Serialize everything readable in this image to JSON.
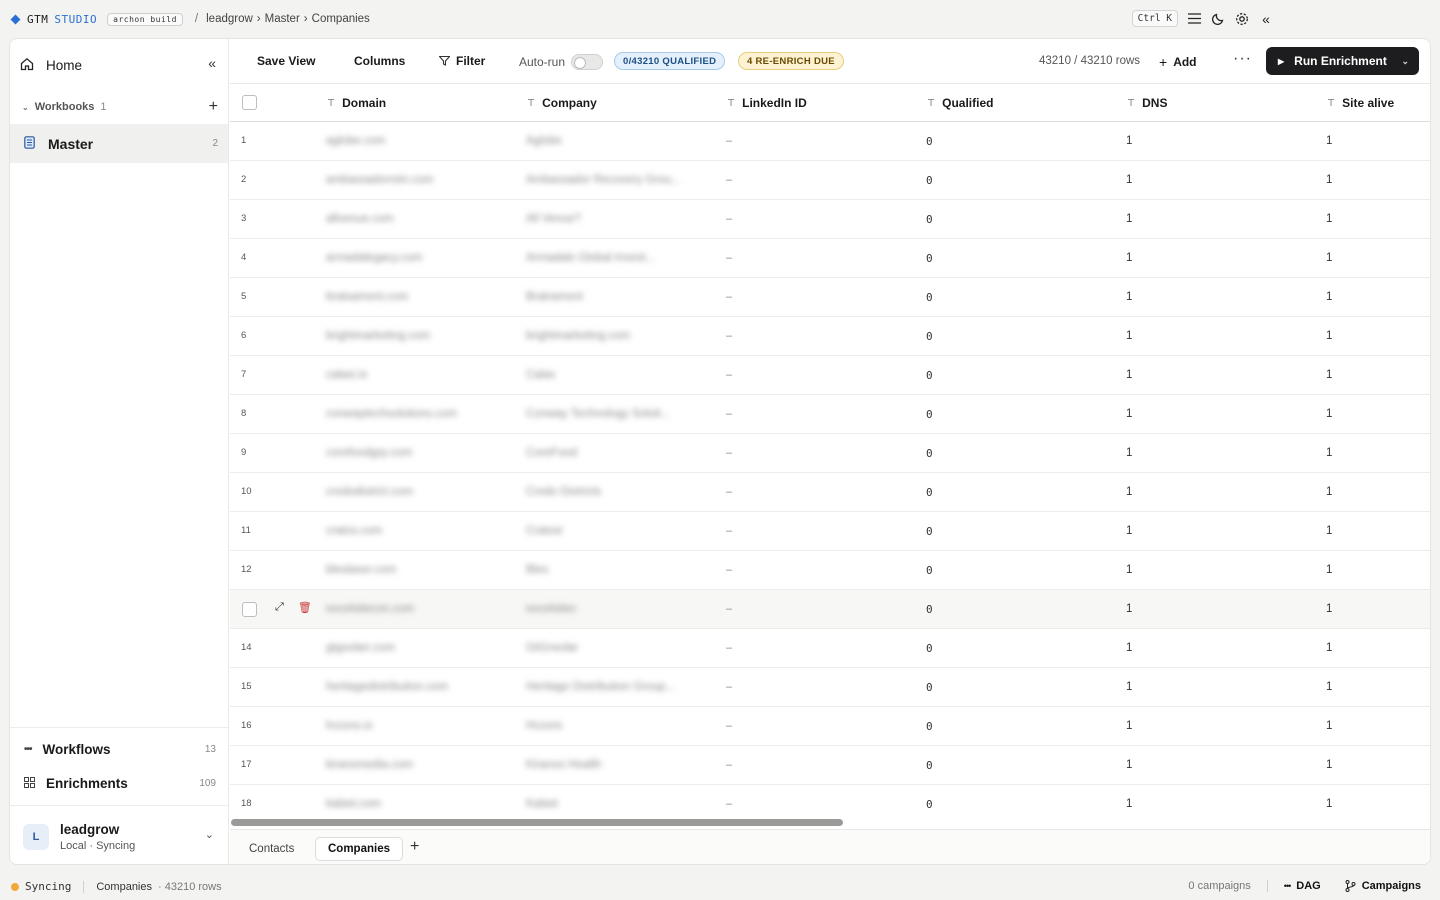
{
  "brand": {
    "name1": "GTM",
    "name2": "STUDIO",
    "tag": "archon build"
  },
  "breadcrumb": {
    "org": "leadgrow",
    "workbook": "Master",
    "sheet": "Companies"
  },
  "top_right": {
    "shortcut": "Ctrl K"
  },
  "sidebar": {
    "home": "Home",
    "workbooks_label": "Workbooks",
    "workbooks_count": "1",
    "master_label": "Master",
    "master_count": "2",
    "workflows_label": "Workflows",
    "workflows_count": "13",
    "enrichments_label": "Enrichments",
    "enrichments_count": "109",
    "user_initial": "L",
    "user_name": "leadgrow",
    "user_status": "Local · Syncing"
  },
  "toolbar": {
    "save_view": "Save View",
    "columns": "Columns",
    "filter": "Filter",
    "autorun": "Auto-run",
    "qualified_badge": "0/43210 QUALIFIED",
    "reenrich_badge": "4 RE-ENRICH DUE",
    "row_count": "43210 / 43210 rows",
    "add": "Add",
    "run": "Run Enrichment"
  },
  "table": {
    "columns": [
      "Domain",
      "Company",
      "LinkedIn ID",
      "Qualified",
      "DNS",
      "Site alive"
    ],
    "rows": [
      {
        "n": "1",
        "domain": "aglobe.com",
        "company": "Aglobe",
        "linkedin": "–",
        "qualified": "0",
        "dns": "1",
        "site": "1"
      },
      {
        "n": "2",
        "domain": "ambassadorrein.com",
        "company": "Ambassador Recovery Grou...",
        "linkedin": "–",
        "qualified": "0",
        "dns": "1",
        "site": "1"
      },
      {
        "n": "3",
        "domain": "allvenue.com",
        "company": "All Venue?",
        "linkedin": "–",
        "qualified": "0",
        "dns": "1",
        "site": "1"
      },
      {
        "n": "4",
        "domain": "armadalegacy.com",
        "company": "Armadale Global Invest...",
        "linkedin": "–",
        "qualified": "0",
        "dns": "1",
        "site": "1"
      },
      {
        "n": "5",
        "domain": "bratsamont.com",
        "company": "Bratramont",
        "linkedin": "–",
        "qualified": "0",
        "dns": "1",
        "site": "1"
      },
      {
        "n": "6",
        "domain": "brightmarketing.com",
        "company": "brightmarketing.com",
        "linkedin": "–",
        "qualified": "0",
        "dns": "1",
        "site": "1"
      },
      {
        "n": "7",
        "domain": "calaxi.io",
        "company": "Calax",
        "linkedin": "–",
        "qualified": "0",
        "dns": "1",
        "site": "1"
      },
      {
        "n": "8",
        "domain": "conwaytechsolutions.com",
        "company": "Conway Technology Soluti...",
        "linkedin": "–",
        "qualified": "0",
        "dns": "1",
        "site": "1"
      },
      {
        "n": "9",
        "domain": "corefoodgrp.com",
        "company": "CoreFood",
        "linkedin": "–",
        "qualified": "0",
        "dns": "1",
        "site": "1"
      },
      {
        "n": "10",
        "domain": "credodistrict.com",
        "company": "Credo Districts",
        "linkedin": "–",
        "qualified": "0",
        "dns": "1",
        "site": "1"
      },
      {
        "n": "11",
        "domain": "cratos.com",
        "company": "Cratosi",
        "linkedin": "–",
        "qualified": "0",
        "dns": "1",
        "site": "1"
      },
      {
        "n": "12",
        "domain": "bleslaser.com",
        "company": "Bles",
        "linkedin": "–",
        "qualified": "0",
        "dns": "1",
        "site": "1"
      },
      {
        "n": "13",
        "domain": "excelsitecon.com",
        "company": "excelsitec",
        "linkedin": "–",
        "qualified": "0",
        "dns": "1",
        "site": "1"
      },
      {
        "n": "14",
        "domain": "gtgsolarr.com",
        "company": "GtGnsolar",
        "linkedin": "–",
        "qualified": "0",
        "dns": "1",
        "site": "1"
      },
      {
        "n": "15",
        "domain": "heritagedistribution.com",
        "company": "Heritage Distribution Group...",
        "linkedin": "–",
        "qualified": "0",
        "dns": "1",
        "site": "1"
      },
      {
        "n": "16",
        "domain": "hrzons.io",
        "company": "Hrzons",
        "linkedin": "–",
        "qualified": "0",
        "dns": "1",
        "site": "1"
      },
      {
        "n": "17",
        "domain": "kiransmedia.com",
        "company": "Kiranos Health",
        "linkedin": "–",
        "qualified": "0",
        "dns": "1",
        "site": "1"
      },
      {
        "n": "18",
        "domain": "kalast.com",
        "company": "Kalast",
        "linkedin": "–",
        "qualified": "0",
        "dns": "1",
        "site": "1"
      }
    ]
  },
  "tabs": [
    "Contacts",
    "Companies"
  ],
  "status": {
    "sync": "Syncing",
    "sheet": "Companies",
    "rows": "· 43210 rows",
    "campaigns_count": "0 campaigns",
    "dag": "DAG",
    "campaigns": "Campaigns"
  },
  "colors": {
    "accent": "#2b6fd6",
    "run_button": "#1d1d1f",
    "qualified_badge": "#e4f0fb",
    "reenrich_badge": "#fdf2d2",
    "delete": "#c83a3a",
    "sync_dot": "#f2a93b"
  }
}
